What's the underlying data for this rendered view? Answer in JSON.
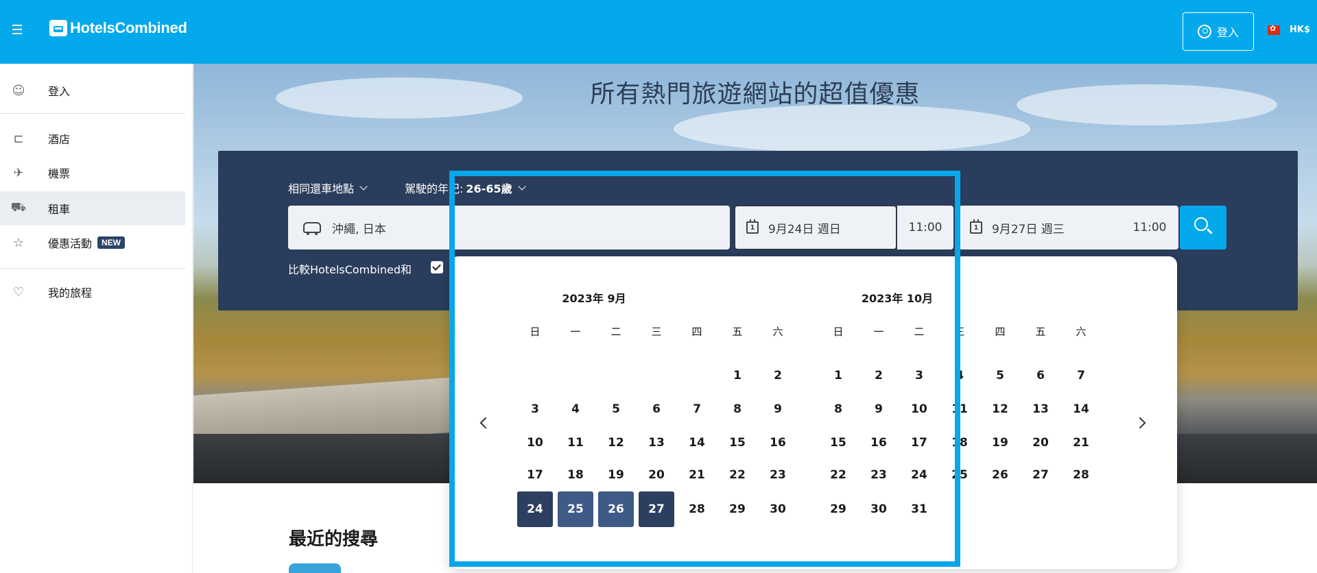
{
  "header": {
    "logo": "HotelsCombined",
    "login_label": "登入",
    "currency": "HK$"
  },
  "sidebar": {
    "login": "登入",
    "items": [
      {
        "label": "酒店",
        "icon": "bed-icon"
      },
      {
        "label": "機票",
        "icon": "plane-icon"
      },
      {
        "label": "租車",
        "icon": "car-icon",
        "active": true
      },
      {
        "label": "優惠活動",
        "icon": "deals-icon",
        "badge": "NEW"
      }
    ],
    "trips": "我的旅程"
  },
  "hero": {
    "title": "所有熱門旅遊網站的超值優惠"
  },
  "search": {
    "return_option": "相同還車地點",
    "driver_age_label": "駕駛的年紀:",
    "driver_age_value": "26-65歲",
    "location": "沖繩, 日本",
    "pickup_date": "9月24日 週日",
    "pickup_date_icon": "1",
    "pickup_time": "11:00",
    "return_date": "9月27日 週三",
    "return_date_icon": "1",
    "return_time": "11:00",
    "compare_label": "比較HotelsCombined和"
  },
  "calendar": {
    "weekdays": [
      "日",
      "一",
      "二",
      "三",
      "四",
      "五",
      "六"
    ],
    "months": [
      {
        "title": "2023年 9月",
        "offset": 5,
        "days": 30,
        "selected_start": 24,
        "selected_end": 27
      },
      {
        "title": "2023年 10月",
        "offset": 0,
        "days": 31
      }
    ]
  },
  "recent": {
    "title": "最近的搜尋"
  }
}
